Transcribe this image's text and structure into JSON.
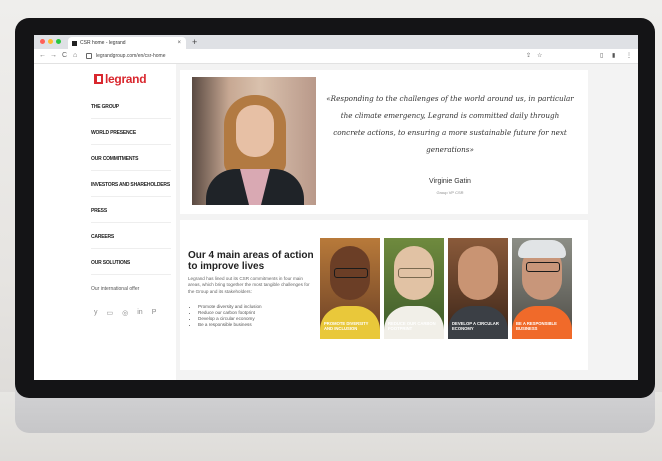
{
  "browser": {
    "tab_title": "CSR home - legrand",
    "new_tab": "+",
    "close_tab": "×",
    "url": "legrandgroup.com/en/csr-home",
    "nav": {
      "back": "←",
      "forward": "→",
      "reload": "C",
      "home": "⌂"
    }
  },
  "sidebar": {
    "logo": "legrand",
    "items": [
      {
        "label": "THE GROUP"
      },
      {
        "label": "WORLD PRESENCE"
      },
      {
        "label": "OUR COMMITMENTS"
      },
      {
        "label": "INVESTORS AND SHAREHOLDERS"
      },
      {
        "label": "PRESS"
      },
      {
        "label": "CAREERS"
      },
      {
        "label": "OUR SOLUTIONS"
      }
    ],
    "international_offer": "Our international offer",
    "social": [
      "y",
      "▭",
      "◎",
      "in",
      "P"
    ]
  },
  "quote_card": {
    "quote": "«Responding to the challenges of the world around us, in particular the climate emergency, Legrand is committed daily through concrete actions, to ensuring a more sustainable future for next generations»",
    "name": "Virginie Gatin",
    "role": "Group VP CSR"
  },
  "areas_card": {
    "title": "Our 4 main areas of action to improve lives",
    "intro": "Legrand has lined out its CSR commitments in four main areas, which bring together the most tangible challenges for the Group and its stakeholders:",
    "bullets": [
      "Promote diversity and inclusion",
      "Reduce our carbon footprint",
      "Develop a circular economy",
      "Be a responsible business"
    ],
    "tiles": [
      {
        "label": "PROMOTE DIVERSITY AND INCLUSION"
      },
      {
        "label": "REDUCE OUR CARBON FOOTPRINT"
      },
      {
        "label": "DEVELOP A CIRCULAR ECONOMY"
      },
      {
        "label": "BE A RESPONSIBLE BUSINESS"
      }
    ]
  },
  "colors": {
    "brand_red": "#d9272e",
    "traffic_red": "#ff5f57",
    "traffic_yellow": "#febc2e",
    "traffic_green": "#28c840"
  }
}
